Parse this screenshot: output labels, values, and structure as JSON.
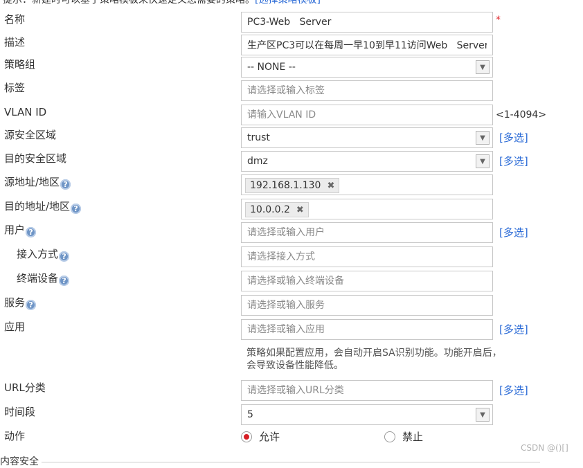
{
  "top_hint": {
    "text": "提示：新建时可以基于策略模板来快速定义您需要的策略。",
    "link": "[选择策略模板]"
  },
  "form": {
    "name": {
      "label": "名称",
      "value": "PC3-Web   Server",
      "required_mark": "*"
    },
    "description": {
      "label": "描述",
      "value": "生产区PC3可以在每周一早10到早11访问Web   Server"
    },
    "policy_group": {
      "label": "策略组",
      "value": "-- NONE --"
    },
    "tags": {
      "label": "标签",
      "placeholder": "请选择或输入标签"
    },
    "vlan_id": {
      "label": "VLAN ID",
      "placeholder": "请输入VLAN ID",
      "range": "<1-4094>"
    },
    "src_zone": {
      "label": "源安全区域",
      "value": "trust",
      "multi": "[多选]"
    },
    "dst_zone": {
      "label": "目的安全区域",
      "value": "dmz",
      "multi": "[多选]"
    },
    "src_addr": {
      "label": "源地址/地区",
      "tag": "192.168.1.130",
      "help": "?"
    },
    "dst_addr": {
      "label": "目的地址/地区",
      "tag": "10.0.0.2",
      "help": "?"
    },
    "user": {
      "label": "用户",
      "placeholder": "请选择或输入用户",
      "multi": "[多选]",
      "help": "?"
    },
    "access_method": {
      "label": "接入方式",
      "placeholder": "请选择接入方式",
      "help": "?"
    },
    "terminal_device": {
      "label": "终端设备",
      "placeholder": "请选择或输入终端设备",
      "help": "?"
    },
    "service": {
      "label": "服务",
      "placeholder": "请选择或输入服务",
      "help": "?"
    },
    "application": {
      "label": "应用",
      "placeholder": "请选择或输入应用",
      "multi": "[多选]",
      "note": "策略如果配置应用，会自动开启SA识别功能。功能开启后，会导致设备性能降低。"
    },
    "url_category": {
      "label": "URL分类",
      "placeholder": "请选择或输入URL分类",
      "multi": "[多选]"
    },
    "time_range": {
      "label": "时间段",
      "value": "5"
    },
    "action": {
      "label": "动作",
      "permit": "允许",
      "deny": "禁止",
      "selected": "permit"
    }
  },
  "section_next": "内容安全",
  "tag_remove": "✖",
  "dropdown_arrow": "▼",
  "watermark": "CSDN @()[]",
  "colors": {
    "link": "#2a6ad6",
    "required": "#e0262b",
    "radio_selected": "#d71f25"
  }
}
